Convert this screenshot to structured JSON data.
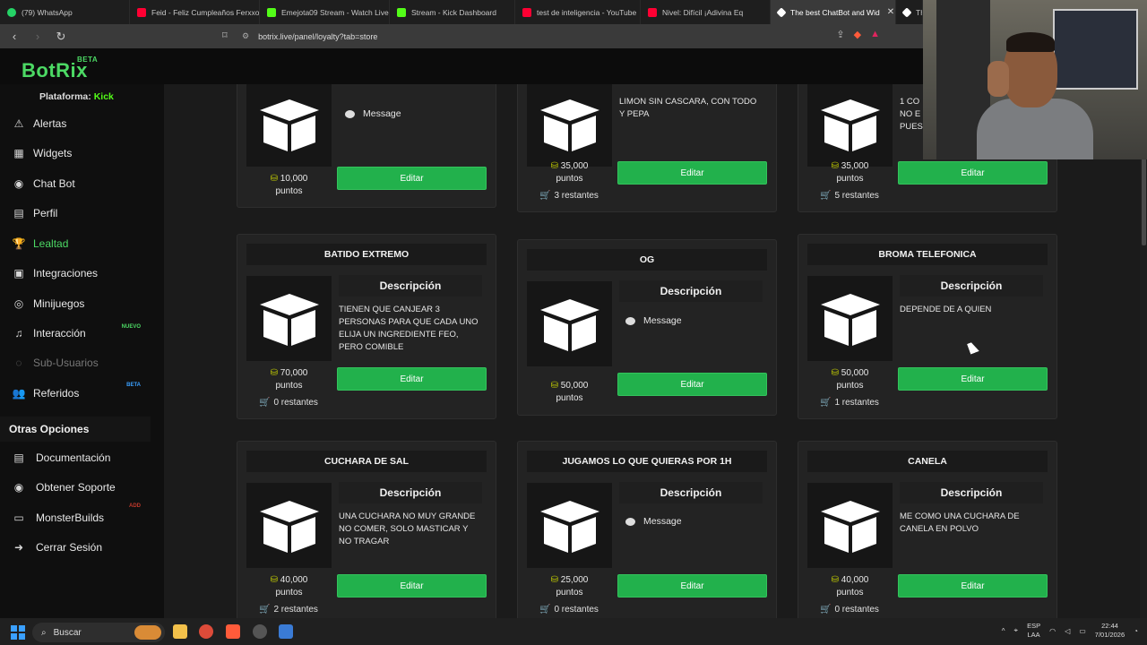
{
  "browser": {
    "tabs": [
      {
        "label": "(79) WhatsApp",
        "color": "#25d366"
      },
      {
        "label": "Feid - Feliz Cumpleaños Ferxxo",
        "color": "#ff0033"
      },
      {
        "label": "Emejota09 Stream - Watch Live",
        "color": "#53fc18"
      },
      {
        "label": "Stream - Kick Dashboard",
        "color": "#53fc18"
      },
      {
        "label": "test de inteligencia - YouTube",
        "color": "#ff0033"
      },
      {
        "label": "Nivel: Difícil ¡Adivina Eq",
        "color": "#ff0033"
      },
      {
        "label": "The best ChatBot and Wid",
        "color": "#ffffff",
        "active": true
      },
      {
        "label": "Th",
        "color": "#ffffff"
      }
    ],
    "close_glyph": "✕",
    "url": "botrix.live/panel/loyalty?tab=store"
  },
  "app": {
    "logo": "BotRix",
    "logo_badge": "BETA",
    "platform_label": "Plataforma:",
    "platform_value": "Kick"
  },
  "sidebar": {
    "items": [
      {
        "label": "Alertas",
        "icon": "⚠"
      },
      {
        "label": "Widgets",
        "icon": "▦"
      },
      {
        "label": "Chat Bot",
        "icon": "◉"
      },
      {
        "label": "Perfil",
        "icon": "▤"
      },
      {
        "label": "Lealtad",
        "icon": "🏆"
      },
      {
        "label": "Integraciones",
        "icon": "▣"
      },
      {
        "label": "Minijuegos",
        "icon": "◎"
      },
      {
        "label": "Interacción",
        "icon": "♫",
        "badge": "NUEVO"
      },
      {
        "label": "Sub-Usuarios",
        "icon": "◌"
      },
      {
        "label": "Referidos",
        "icon": "👥",
        "badge": "BETA"
      }
    ],
    "section_title": "Otras Opciones",
    "sub_items": [
      {
        "label": "Documentación",
        "icon": "▤"
      },
      {
        "label": "Obtener Soporte",
        "icon": "◉"
      },
      {
        "label": "MonsterBuilds",
        "icon": "▭",
        "badge": "ADD"
      },
      {
        "label": "Cerrar Sesión",
        "icon": "➜"
      }
    ]
  },
  "cards": [
    {
      "title": "",
      "desc_header": "",
      "message": "Message",
      "price": "10,000",
      "unit": "puntos",
      "button": "Editar",
      "remaining": ""
    },
    {
      "title": "",
      "desc_header": "",
      "description": "LIMON SIN CASCARA, CON TODO Y PEPA",
      "price": "35,000",
      "unit": "puntos",
      "button": "Editar",
      "remaining": "3 restantes"
    },
    {
      "title": "",
      "desc_header": "",
      "description": "1 CO NO E PUES",
      "price": "35,000",
      "unit": "puntos",
      "button": "Editar",
      "remaining": "5 restantes"
    },
    {
      "title": "BATIDO EXTREMO",
      "desc_header": "Descripción",
      "description": "TIENEN QUE CANJEAR 3 PERSONAS PARA QUE CADA UNO ELIJA UN INGREDIENTE FEO, PERO COMIBLE",
      "price": "70,000",
      "unit": "puntos",
      "button": "Editar",
      "remaining": "0 restantes"
    },
    {
      "title": "OG",
      "desc_header": "Descripción",
      "message": "Message",
      "price": "50,000",
      "unit": "puntos",
      "button": "Editar",
      "remaining": ""
    },
    {
      "title": "BROMA TELEFONICA",
      "desc_header": "Descripción",
      "description": "DEPENDE DE A QUIEN",
      "price": "50,000",
      "unit": "puntos",
      "button": "Editar",
      "remaining": "1 restantes"
    },
    {
      "title": "CUCHARA DE SAL",
      "desc_header": "Descripción",
      "description": "UNA CUCHARA NO MUY GRANDE NO COMER, SOLO MASTICAR Y NO TRAGAR",
      "price": "40,000",
      "unit": "puntos",
      "button": "Editar",
      "remaining": "2 restantes"
    },
    {
      "title": "JUGAMOS LO QUE QUIERAS POR 1H",
      "desc_header": "Descripción",
      "message": "Message",
      "price": "25,000",
      "unit": "puntos",
      "button": "Editar",
      "remaining": "0 restantes"
    },
    {
      "title": "CANELA",
      "desc_header": "Descripción",
      "description": "ME COMO UNA CUCHARA DE CANELA EN POLVO",
      "price": "40,000",
      "unit": "puntos",
      "button": "Editar",
      "remaining": "0 restantes"
    }
  ],
  "taskbar": {
    "search": "Buscar",
    "lang_top": "ESP",
    "lang_bottom": "LAA",
    "time": "22:44",
    "date": "7/01/2026"
  }
}
